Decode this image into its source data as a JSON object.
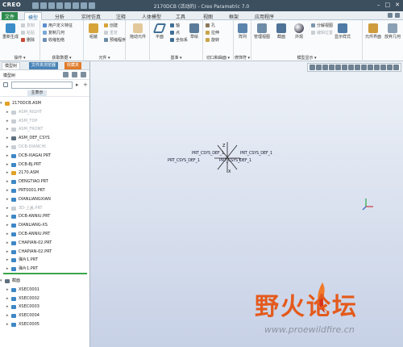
{
  "app": {
    "logo": "CREO",
    "window_title": "2170DCB (活动的) - Creo Parametric 7.0"
  },
  "tabs": [
    {
      "label": "文件"
    },
    {
      "label": "模型"
    },
    {
      "label": "分析"
    },
    {
      "label": "实时仿真"
    },
    {
      "label": "注释"
    },
    {
      "label": "人体模型"
    },
    {
      "label": "工具"
    },
    {
      "label": "视图"
    },
    {
      "label": "框架"
    },
    {
      "label": "应用程序"
    }
  ],
  "ribbon": {
    "groups": [
      {
        "label": "操作 ▾",
        "items": [
          "重新生成",
          "复制",
          "粘贴",
          "删除"
        ]
      },
      {
        "label": "获取数据 ▾",
        "items": [
          "用户定义特征",
          "复制几何",
          "收缩包络"
        ]
      },
      {
        "label": "元件 ▾",
        "items": [
          "组装",
          "创建",
          "重复",
          "预缩程序"
        ]
      },
      {
        "label": "",
        "items": [
          "拖动元件"
        ]
      },
      {
        "label": "基准 ▾",
        "items": [
          "平面",
          "轴",
          "点",
          "坐标系",
          "草绘"
        ]
      },
      {
        "label": "切口和曲面 ▾",
        "items": [
          "孔",
          "拉伸",
          "旋转"
        ]
      },
      {
        "label": "修饰符 ▾",
        "items": [
          "阵列"
        ]
      },
      {
        "label": "模型显示 ▾",
        "items": [
          "管理视图",
          "截面",
          "外观",
          "显示样式",
          "分解视图",
          "编辑位置"
        ]
      },
      {
        "label": "",
        "items": [
          "元件界面",
          "放弃几何"
        ]
      }
    ]
  },
  "panel": {
    "tabs": [
      "模型树",
      "文件夹浏览器",
      "收藏夹"
    ],
    "tree_label": "模型树",
    "column_header": "主表示",
    "filter_placeholder": "",
    "tree_items": [
      {
        "label": "2170DCB.ASM",
        "level": 0,
        "dim": false,
        "color": "#e0a126"
      },
      {
        "label": "ASM_RIGHT",
        "level": 1,
        "dim": true,
        "color": "#c8ced3"
      },
      {
        "label": "ASM_TOP",
        "level": 1,
        "dim": true,
        "color": "#c8ced3"
      },
      {
        "label": "ASM_FRONT",
        "level": 1,
        "dim": true,
        "color": "#c8ced3"
      },
      {
        "label": "ASM_DEF_CSYS",
        "level": 1,
        "dim": false,
        "color": "#5c6f7e"
      },
      {
        "label": "DCB-DIANCHI",
        "level": 1,
        "dim": true,
        "color": "#c8ced3"
      },
      {
        "label": "DCB-XIAGAI.PRT",
        "level": 1,
        "dim": false,
        "color": "#3d87c6"
      },
      {
        "label": "DCB-BJ.PRT",
        "level": 1,
        "dim": false,
        "color": "#3d87c6"
      },
      {
        "label": "2170.ASM",
        "level": 1,
        "dim": false,
        "color": "#e0a126"
      },
      {
        "label": "DENGTIAO.PRT",
        "level": 1,
        "dim": false,
        "color": "#3d87c6"
      },
      {
        "label": "PRT0001.PRT",
        "level": 1,
        "dim": false,
        "color": "#3d87c6"
      },
      {
        "label": "DIANLIANGXIAN",
        "level": 1,
        "dim": false,
        "color": "#3d87c6"
      },
      {
        "label": "3D-上盖.PRT",
        "level": 1,
        "dim": true,
        "color": "#c8ced3"
      },
      {
        "label": "DCB-ANNIU.PRT",
        "level": 1,
        "dim": false,
        "color": "#3d87c6"
      },
      {
        "label": "DIANLIANG-XS",
        "level": 1,
        "dim": false,
        "color": "#3d87c6"
      },
      {
        "label": "DCB-ANNIU.PRT",
        "level": 1,
        "dim": false,
        "color": "#3d87c6"
      },
      {
        "label": "CHAPIAN-02.PRT",
        "level": 1,
        "dim": false,
        "color": "#3d87c6"
      },
      {
        "label": "CHAPIAN-02.PRT",
        "level": 1,
        "dim": false,
        "color": "#3d87c6"
      },
      {
        "label": "弹片1.PRT",
        "level": 1,
        "dim": false,
        "color": "#3d87c6"
      },
      {
        "label": "弹片1.PRT",
        "level": 1,
        "dim": false,
        "color": "#3d87c6"
      }
    ],
    "section_items": [
      {
        "label": "截面",
        "level": 0,
        "color": "#5c6f7e"
      },
      {
        "label": "XSEC0001",
        "level": 1,
        "color": "#3d87c6"
      },
      {
        "label": "XSEC0002",
        "level": 1,
        "color": "#3d87c6"
      },
      {
        "label": "XSEC0003",
        "level": 1,
        "color": "#3d87c6"
      },
      {
        "label": "XSEC0004",
        "level": 1,
        "color": "#3d87c6"
      },
      {
        "label": "XSEC0005",
        "level": 1,
        "color": "#3d87c6"
      }
    ]
  },
  "graphics": {
    "datum_labels": [
      "PRT_CSYS_DEF_1",
      "PRT_CSYS_DEF_1"
    ],
    "watermark_text": "野火论坛",
    "watermark_url": "www.proewildfire.cn"
  },
  "colors": {
    "accent": "#2e8c4e",
    "watermark": "#e45a1c"
  }
}
